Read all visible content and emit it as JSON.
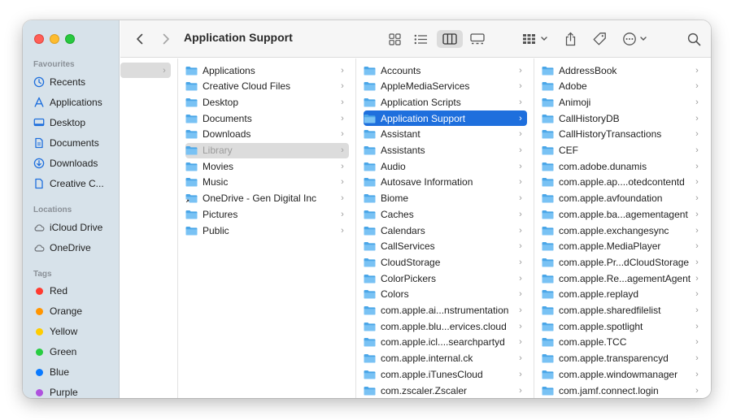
{
  "colors": {
    "accent": "#1e6fdd",
    "sidebar_bg": "#d7e2ea",
    "folder": "#5ab0ec"
  },
  "toolbar": {
    "title": "Application Support",
    "back_icon": "chevron-left-icon",
    "forward_icon": "chevron-right-icon",
    "views": [
      "icon-view-icon",
      "list-view-icon",
      "column-view-icon",
      "gallery-view-icon"
    ],
    "active_view": "column-view-icon",
    "actions": [
      "group-icon",
      "share-icon",
      "tag-icon",
      "more-icon",
      "search-icon"
    ]
  },
  "sidebar": {
    "favourites_heading": "Favourites",
    "favourites": [
      {
        "label": "Recents",
        "icon": "clock-icon"
      },
      {
        "label": "Applications",
        "icon": "applications-icon"
      },
      {
        "label": "Desktop",
        "icon": "desktop-icon"
      },
      {
        "label": "Documents",
        "icon": "document-icon"
      },
      {
        "label": "Downloads",
        "icon": "download-icon"
      },
      {
        "label": "Creative C...",
        "icon": "file-icon"
      }
    ],
    "locations_heading": "Locations",
    "locations": [
      {
        "label": "iCloud Drive",
        "icon": "cloud-icon"
      },
      {
        "label": "OneDrive",
        "icon": "cloud-icon"
      }
    ],
    "tags_heading": "Tags",
    "tags": [
      {
        "label": "Red",
        "color": "#ff3b30"
      },
      {
        "label": "Orange",
        "color": "#ff9500"
      },
      {
        "label": "Yellow",
        "color": "#ffcc00"
      },
      {
        "label": "Green",
        "color": "#28cd41"
      },
      {
        "label": "Blue",
        "color": "#0a7aff"
      },
      {
        "label": "Purple",
        "color": "#af52de"
      }
    ]
  },
  "columns": {
    "col2": [
      {
        "label": "Applications"
      },
      {
        "label": "Creative Cloud Files"
      },
      {
        "label": "Desktop"
      },
      {
        "label": "Documents"
      },
      {
        "label": "Downloads"
      },
      {
        "label": "Library",
        "state": "dim"
      },
      {
        "label": "Movies"
      },
      {
        "label": "Music"
      },
      {
        "label": "OneDrive - Gen Digital Inc"
      },
      {
        "label": "Pictures"
      },
      {
        "label": "Public"
      }
    ],
    "col3": [
      {
        "label": "Accounts"
      },
      {
        "label": "AppleMediaServices"
      },
      {
        "label": "Application Scripts"
      },
      {
        "label": "Application Support",
        "state": "selected"
      },
      {
        "label": "Assistant"
      },
      {
        "label": "Assistants"
      },
      {
        "label": "Audio"
      },
      {
        "label": "Autosave Information"
      },
      {
        "label": "Biome"
      },
      {
        "label": "Caches"
      },
      {
        "label": "Calendars"
      },
      {
        "label": "CallServices"
      },
      {
        "label": "CloudStorage"
      },
      {
        "label": "ColorPickers"
      },
      {
        "label": "Colors"
      },
      {
        "label": "com.apple.ai...nstrumentation"
      },
      {
        "label": "com.apple.blu...ervices.cloud"
      },
      {
        "label": "com.apple.icl....searchpartyd"
      },
      {
        "label": "com.apple.internal.ck"
      },
      {
        "label": "com.apple.iTunesCloud"
      },
      {
        "label": "com.zscaler.Zscaler"
      }
    ],
    "col4": [
      {
        "label": "AddressBook"
      },
      {
        "label": "Adobe"
      },
      {
        "label": "Animoji"
      },
      {
        "label": "CallHistoryDB"
      },
      {
        "label": "CallHistoryTransactions"
      },
      {
        "label": "CEF"
      },
      {
        "label": "com.adobe.dunamis"
      },
      {
        "label": "com.apple.ap....otedcontentd"
      },
      {
        "label": "com.apple.avfoundation"
      },
      {
        "label": "com.apple.ba...agementagent"
      },
      {
        "label": "com.apple.exchangesync"
      },
      {
        "label": "com.apple.MediaPlayer"
      },
      {
        "label": "com.apple.Pr...dCloudStorage"
      },
      {
        "label": "com.apple.Re...agementAgent"
      },
      {
        "label": "com.apple.replayd"
      },
      {
        "label": "com.apple.sharedfilelist"
      },
      {
        "label": "com.apple.spotlight"
      },
      {
        "label": "com.apple.TCC"
      },
      {
        "label": "com.apple.transparencyd"
      },
      {
        "label": "com.apple.windowmanager"
      },
      {
        "label": "com.jamf.connect.login"
      }
    ]
  }
}
